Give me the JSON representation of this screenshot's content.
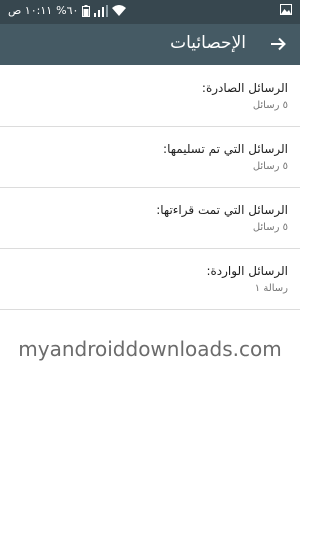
{
  "status_bar": {
    "time": "١٠:١١ ص",
    "battery": "%٦٠"
  },
  "app_bar": {
    "title": "الإحصائيات"
  },
  "stats": [
    {
      "label": "الرسائل الصادرة:",
      "value": "٥ رسائل"
    },
    {
      "label": "الرسائل التي تم تسليمها:",
      "value": "٥ رسائل"
    },
    {
      "label": "الرسائل التي تمت قراءتها:",
      "value": "٥ رسائل"
    },
    {
      "label": "الرسائل الواردة:",
      "value": "رسالة ١"
    }
  ],
  "watermark": "myandroiddownloads.com"
}
